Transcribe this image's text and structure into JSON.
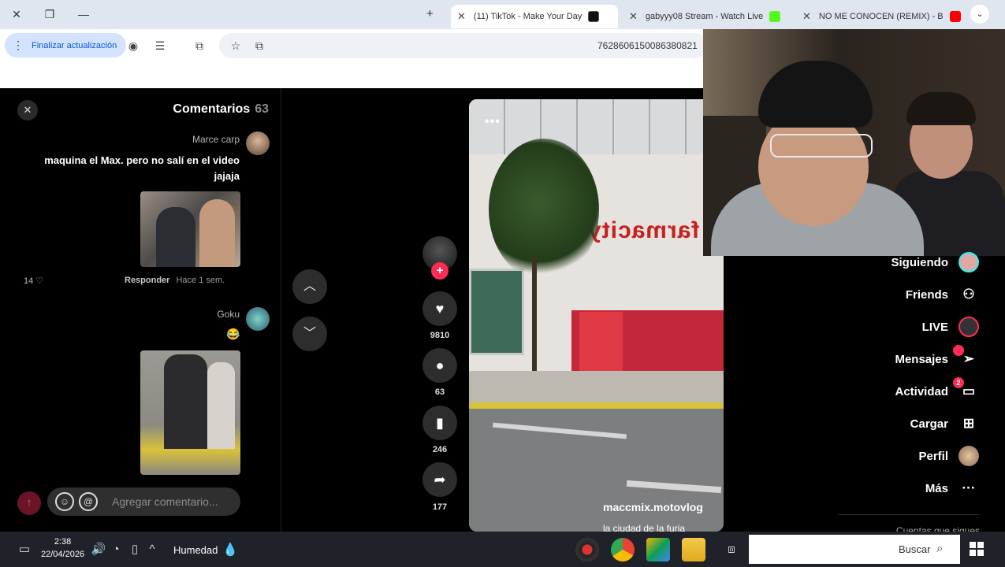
{
  "browser": {
    "tabs": [
      {
        "title": "(11) TikTok - Make Your Day",
        "active": true
      },
      {
        "title": "gabyyy08 Stream - Watch Live",
        "active": false
      },
      {
        "title": "NO ME CONOCEN (REMIX) - B",
        "active": false
      }
    ],
    "new_tab_label": "+",
    "update_button": "Finalizar actualización",
    "url": "7628606150086380821"
  },
  "comments": {
    "title": "Comentarios",
    "count": "63",
    "items": [
      {
        "user": "Marce carp",
        "text_line1": "maquina el Max. pero no salí en el video",
        "text_line2": "jajaja",
        "time": "Hace 1 sem.",
        "reply": "Responder",
        "likes": "14"
      },
      {
        "user": "Goku",
        "emoji": "😂"
      }
    ],
    "add_placeholder": "Agregar comentario...",
    "at_symbol": "@"
  },
  "actions": {
    "likes": "9810",
    "comments": "63",
    "saves": "246",
    "shares": "177"
  },
  "video": {
    "more": "•••",
    "sign": "farmacity",
    "author": "maccmix.motovlog",
    "caption": "la ciudad de la furia"
  },
  "sidebar": {
    "items": [
      {
        "label": "Siguiendo",
        "icon": "following-avatar-icon"
      },
      {
        "label": "Friends",
        "icon": "friends-icon"
      },
      {
        "label": "LIVE",
        "icon": "live-icon"
      },
      {
        "label": "Mensajes",
        "icon": "messages-icon",
        "badge": ""
      },
      {
        "label": "Actividad",
        "icon": "activity-icon",
        "badge": "2"
      },
      {
        "label": "Cargar",
        "icon": "upload-icon"
      },
      {
        "label": "Perfil",
        "icon": "profile-avatar-icon"
      },
      {
        "label": "Más",
        "icon": "more-icon"
      }
    ],
    "following_accounts": "Cuentas que sigues"
  },
  "taskbar": {
    "time": "2:38",
    "date": "22/04/2026",
    "weather": "Humedad",
    "search_label": "Buscar"
  },
  "colors": {
    "accent": "#fe2c55",
    "update_pill_bg": "#d3e3fd",
    "taskbar_bg": "#1f2229"
  }
}
